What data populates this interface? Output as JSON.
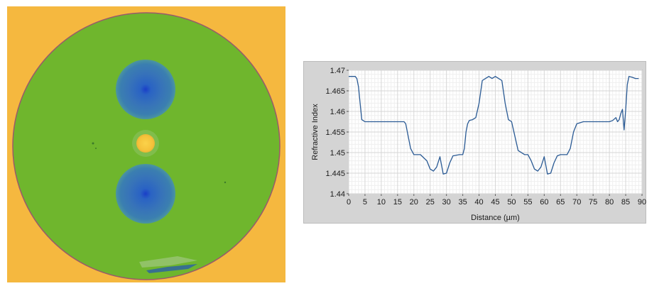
{
  "colors": {
    "background_orange": "#f5b83f",
    "cladding_green": "#6fb62d",
    "stress_rod_blue": "#2e6fbe",
    "core_yellow": "#f7c53e",
    "plot_line": "#2a5a94",
    "plot_bg": "#ffffff",
    "panel_bg": "#d4d4d4",
    "grid": "#dcdcdc"
  },
  "chart_data": {
    "type": "line",
    "xlabel": "Distance (µm)",
    "ylabel": "Refractive Index",
    "xlim": [
      0,
      90
    ],
    "ylim": [
      1.44,
      1.47
    ],
    "x_ticks": [
      "0",
      "5",
      "10",
      "15",
      "20",
      "25",
      "30",
      "35",
      "40",
      "45",
      "50",
      "55",
      "60",
      "65",
      "70",
      "75",
      "80",
      "85",
      "90"
    ],
    "y_ticks": [
      "1.44",
      "1.445",
      "1.45",
      "1.455",
      "1.46",
      "1.465",
      "1.47"
    ],
    "grid": true,
    "series": [
      {
        "x": [
          0,
          2,
          2.5,
          3,
          3.5,
          4,
          5,
          8,
          12,
          15,
          16.5,
          17,
          17.5,
          18,
          19,
          20,
          22,
          24,
          25,
          26,
          27,
          28,
          29,
          30,
          31,
          32,
          34,
          35,
          35.5,
          36,
          36.5,
          37,
          38,
          39,
          40,
          41,
          42,
          43,
          44,
          45,
          46,
          47,
          48,
          49,
          50,
          51,
          52,
          54,
          55,
          56,
          57,
          58,
          59,
          60,
          61,
          62,
          63,
          64,
          65,
          66,
          67,
          68,
          69,
          70,
          72,
          75,
          78,
          80,
          81,
          82,
          82.5,
          83,
          83.5,
          84,
          84.5,
          85,
          85.5,
          86,
          87,
          88,
          89
        ],
        "y": [
          1.4685,
          1.4685,
          1.468,
          1.466,
          1.462,
          1.458,
          1.4575,
          1.4575,
          1.4575,
          1.4575,
          1.4575,
          1.4575,
          1.457,
          1.455,
          1.451,
          1.4495,
          1.4495,
          1.448,
          1.446,
          1.4455,
          1.4465,
          1.449,
          1.4448,
          1.445,
          1.4475,
          1.4492,
          1.4495,
          1.4495,
          1.451,
          1.455,
          1.457,
          1.4578,
          1.458,
          1.4585,
          1.462,
          1.4675,
          1.468,
          1.4685,
          1.468,
          1.4685,
          1.468,
          1.4675,
          1.462,
          1.458,
          1.4575,
          1.454,
          1.4505,
          1.4495,
          1.4495,
          1.448,
          1.446,
          1.4455,
          1.4465,
          1.449,
          1.4448,
          1.445,
          1.4475,
          1.4492,
          1.4495,
          1.4495,
          1.4495,
          1.451,
          1.455,
          1.457,
          1.4575,
          1.4575,
          1.4575,
          1.4575,
          1.4578,
          1.4585,
          1.4575,
          1.458,
          1.4595,
          1.4605,
          1.4555,
          1.4605,
          1.4665,
          1.4685,
          1.4683,
          1.468,
          1.468
        ]
      }
    ]
  }
}
